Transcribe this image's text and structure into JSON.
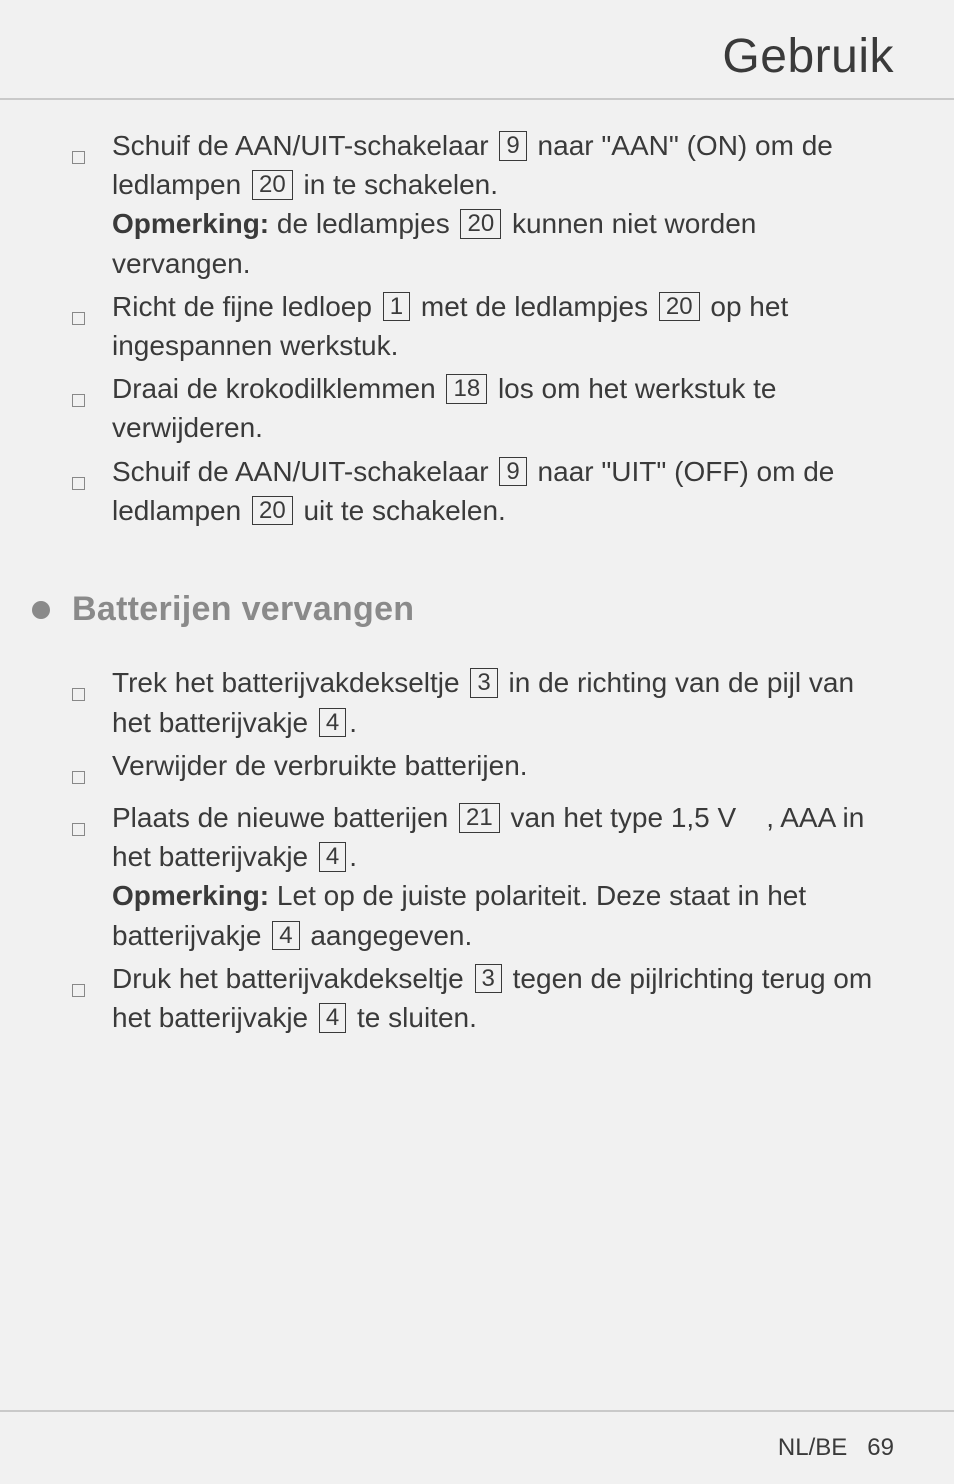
{
  "header": {
    "title": "Gebruik"
  },
  "section1": {
    "items": [
      {
        "t1": "Schuif de AAN/UIT-schakelaar ",
        "r1": "9",
        "t2": " naar \"AAN\" (ON) om de ledlampen ",
        "r2": "20",
        "t3": " in te schakelen.",
        "note_label": "Opmerking:",
        "note_t1": " de ledlampjes ",
        "note_r1": "20",
        "note_t2": " kunnen niet worden vervangen."
      },
      {
        "t1": "Richt de fijne ledloep ",
        "r1": "1",
        "t2": " met de ledlampjes ",
        "r2": "20",
        "t3": " op het ingespannen werkstuk."
      },
      {
        "t1": "Draai de krokodilklemmen ",
        "r1": "18",
        "t2": " los om het werkstuk te verwijderen."
      },
      {
        "t1": "Schuif de AAN/UIT-schakelaar ",
        "r1": "9",
        "t2": " naar \"UIT\" (OFF) om de ledlampen ",
        "r2": "20",
        "t3": " uit te schakelen."
      }
    ]
  },
  "section2": {
    "title": "Batterijen vervangen",
    "items": [
      {
        "t1": "Trek het batterijvakdekseltje ",
        "r1": "3",
        "t2": " in de richting van de pijl van het batterijvakje ",
        "r2": "4",
        "t3": "."
      },
      {
        "t1": "Verwijder de verbruikte batterijen."
      },
      {
        "t1": "Plaats de nieuwe batterijen ",
        "r1": "21",
        "t2": " van het type 1,5 V",
        "t3": ", AAA in het batterijvakje ",
        "r2": "4",
        "t4": ".",
        "note_label": "Opmerking:",
        "note_t1": " Let op de juiste polariteit. Deze staat in het batterijvakje ",
        "note_r1": "4",
        "note_t2": " aangegeven."
      },
      {
        "t1": "Druk het batterijvakdekseltje ",
        "r1": "3",
        "t2": " tegen de pijlrichting terug om het batterijvakje ",
        "r2": "4",
        "t3": " te sluiten."
      }
    ]
  },
  "footer": {
    "lang": "NL/BE",
    "page": "69"
  }
}
